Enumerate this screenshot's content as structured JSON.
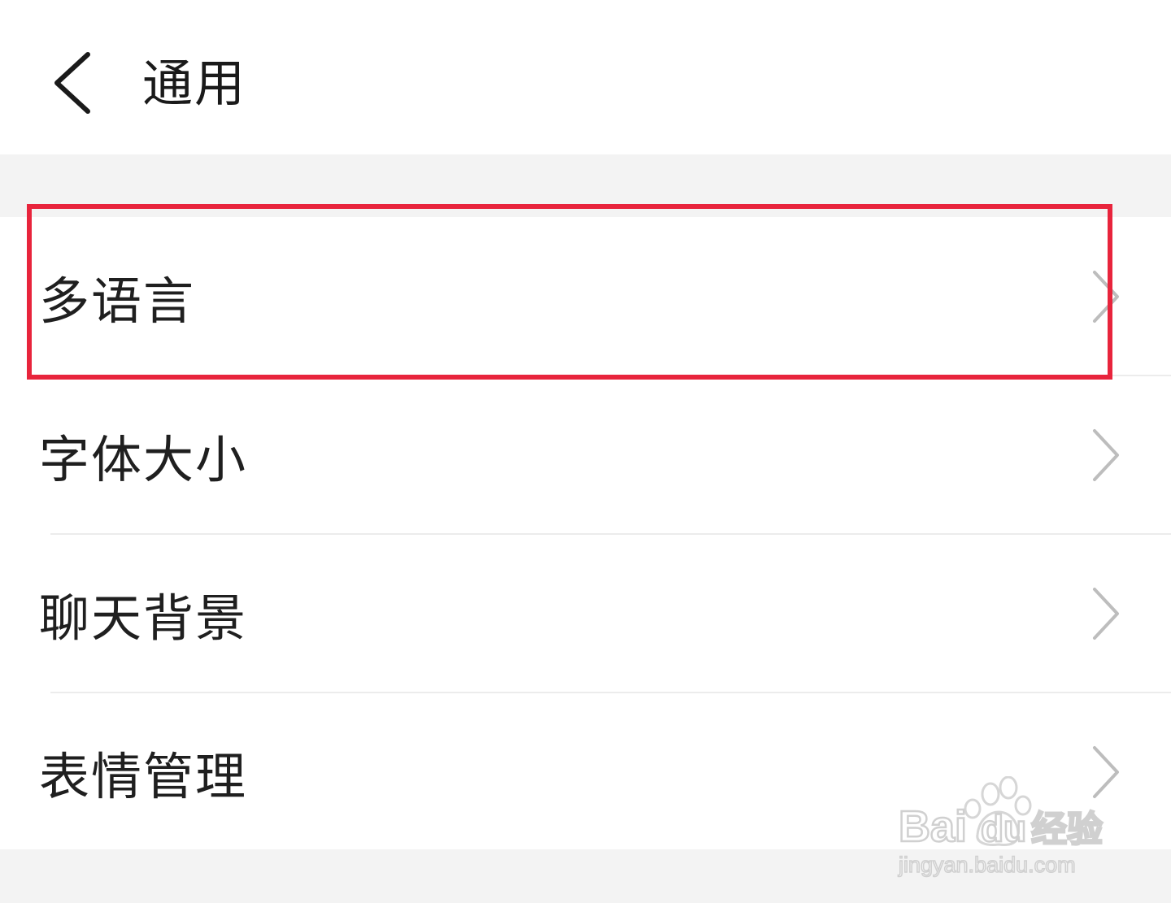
{
  "header": {
    "title": "通用",
    "back_icon": "chevron-left-icon"
  },
  "settings": {
    "items": [
      {
        "label": "多语言",
        "icon": "chevron-right-icon",
        "highlighted": true
      },
      {
        "label": "字体大小",
        "icon": "chevron-right-icon"
      },
      {
        "label": "聊天背景",
        "icon": "chevron-right-icon"
      },
      {
        "label": "表情管理",
        "icon": "chevron-right-icon"
      }
    ]
  },
  "annotation": {
    "highlight_color": "#e8243c"
  },
  "watermark": {
    "brand_a": "Bai",
    "brand_b": "du",
    "brand_c": "经验",
    "url": "jingyan.baidu.com"
  },
  "colors": {
    "background": "#ffffff",
    "section_gray": "#f3f3f3",
    "text": "#1f1f1f",
    "chevron": "#bdbdbd"
  }
}
